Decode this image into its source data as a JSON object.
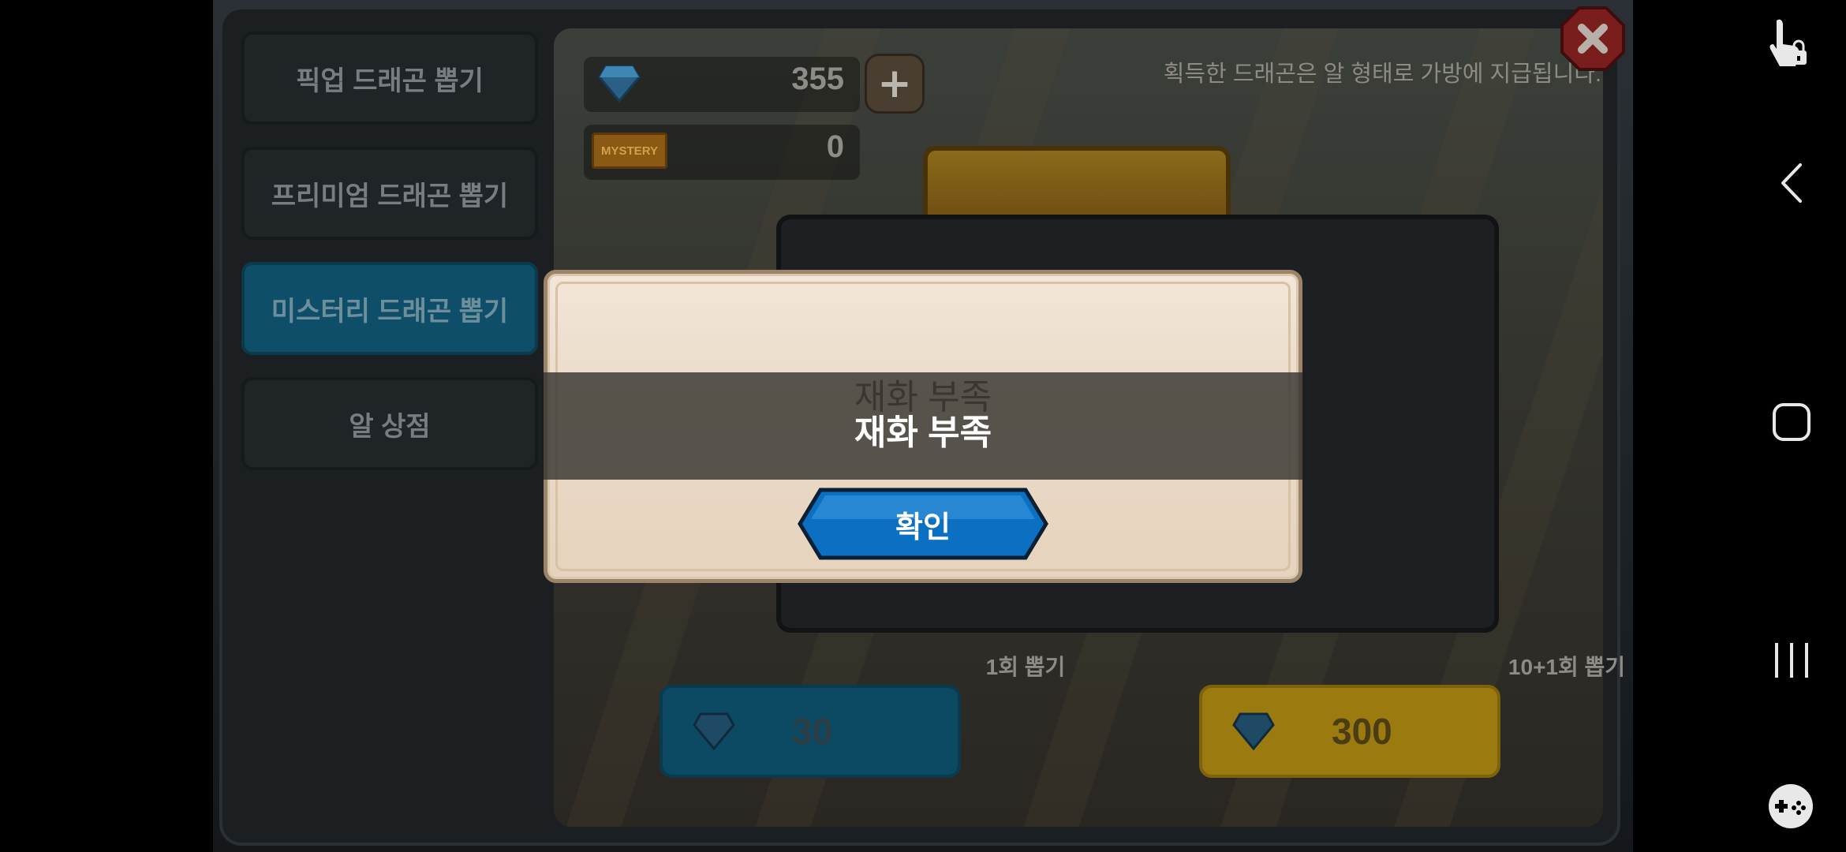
{
  "tabs": [
    {
      "label": "픽업 드래곤 뽑기"
    },
    {
      "label": "프리미엄 드래곤 뽑기"
    },
    {
      "label": "미스터리 드래곤 뽑기"
    },
    {
      "label": "알 상점"
    }
  ],
  "currencies": {
    "diamond": {
      "value": "355",
      "icon": "diamond-icon"
    },
    "mystery_ticket": {
      "value": "0",
      "icon_text": "MYSTERY"
    }
  },
  "notice": "획득한 드래곤은 알 형태로 가방에 지급됩니다.",
  "pulls": {
    "single": {
      "label": "1회 뽑기",
      "cost": "30"
    },
    "ten": {
      "label": "10+1회 뽑기",
      "cost": "300"
    }
  },
  "dialog": {
    "message_shadow": "재화 부족",
    "message": "재화 부족",
    "confirm_label": "확인"
  },
  "colors": {
    "confirm_button": "#0b6fc2",
    "dialog_bg": "#efe1cf",
    "active_tab": "#0f4e68",
    "ten_pull": "#9b7a10"
  }
}
